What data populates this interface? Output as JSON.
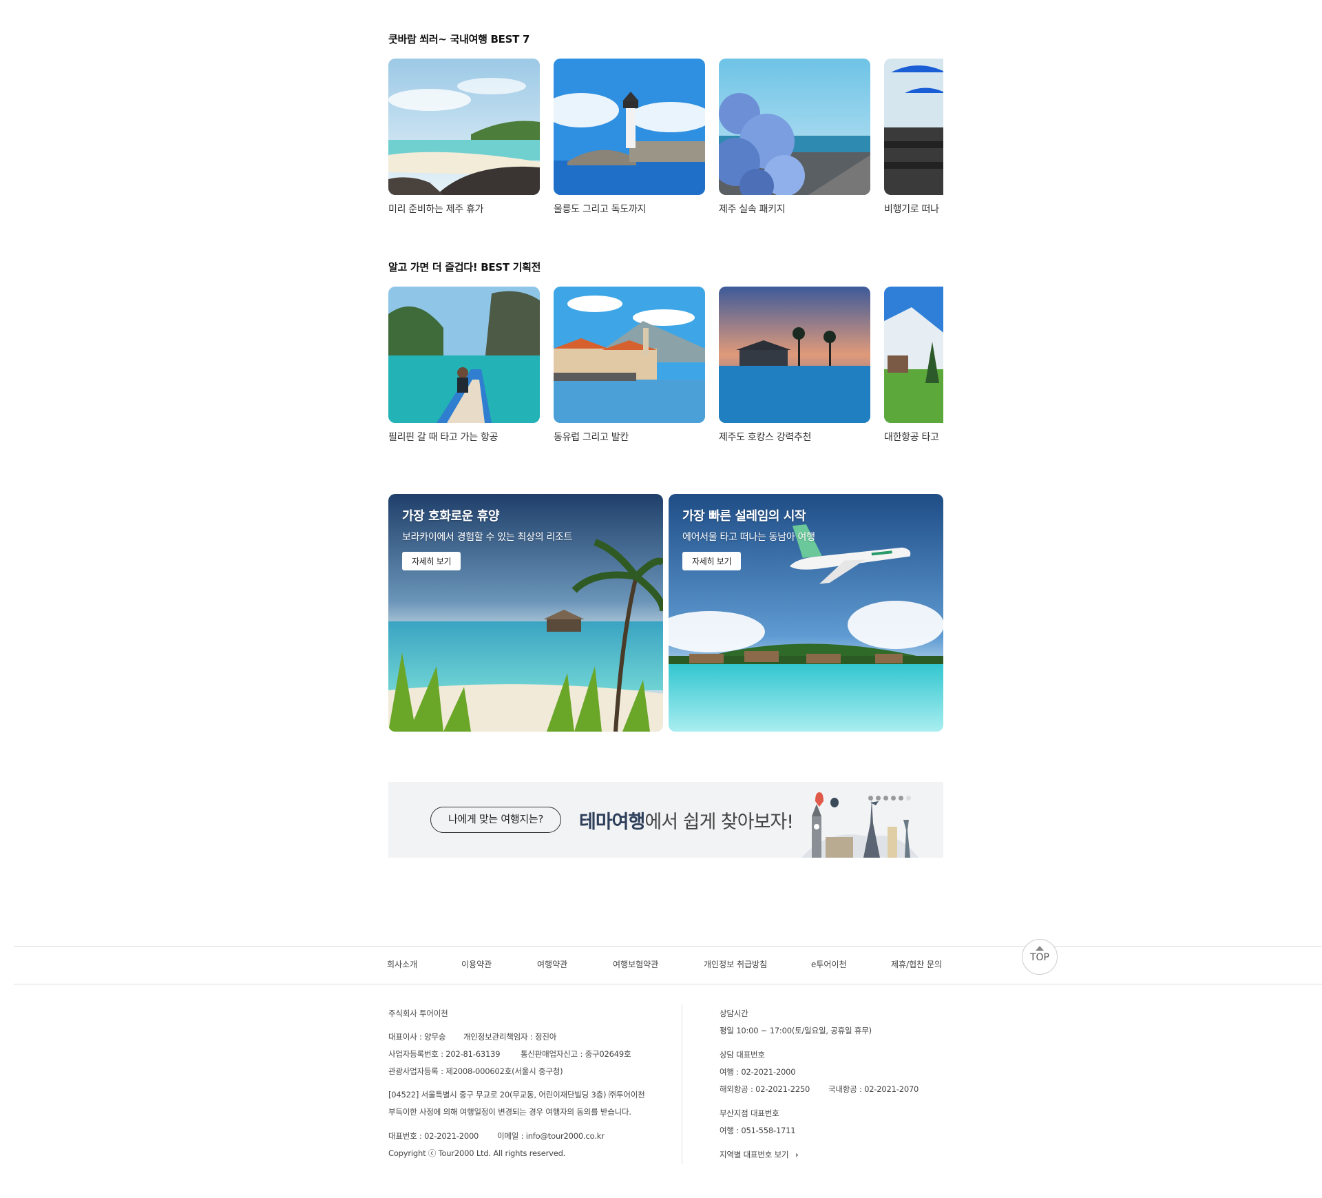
{
  "section1": {
    "title": "쿳바람 쐬러~ 국내여행 BEST 7",
    "cards": [
      {
        "caption": "미리 준비하는 제주 휴가"
      },
      {
        "caption": "울릉도 그리고 독도까지"
      },
      {
        "caption": "제주 실속 패키지"
      },
      {
        "caption": "비행기로 떠나"
      }
    ]
  },
  "section2": {
    "title": "알고 가면 더 즐겁다! BEST 기획전",
    "cards": [
      {
        "caption": "필리핀 갈 때 타고 가는 항공"
      },
      {
        "caption": "동유럽 그리고 발칸"
      },
      {
        "caption": "제주도 호캉스 강력추천"
      },
      {
        "caption": "대한항공 타고"
      }
    ]
  },
  "promos": [
    {
      "heading": "가장 호화로운 휴양",
      "sub": "보라카이에서 경험할 수 있는 최상의 리조트",
      "button": "자세히 보기"
    },
    {
      "heading": "가장 빠른 설레임의 시작",
      "sub": "에어서울 타고 떠나는 동남아 여행",
      "button": "자세히 보기"
    }
  ],
  "theme_banner": {
    "pill": "나에게 맞는 여행지는?",
    "slogan_bold": "테마여행",
    "slogan_rest": "에서 쉽게 찾아보자!"
  },
  "footer_nav": [
    "회사소개",
    "이용약관",
    "여행약관",
    "여행보험약관",
    "개인정보 취급방침",
    "e투어이천",
    "제휴/협찬 문의"
  ],
  "top_button": "TOP",
  "company": {
    "name": "주식회사 투어이천",
    "ceo": "대표이사 : 양무승",
    "privacy_officer": "개인정보관리책임자 : 정진아",
    "biz_reg": "사업자등록번호 : 202-81-63139",
    "mail_order": "통신판매업자신고 : 중구02649호",
    "tour_reg": "관광사업자등록 : 제2008-000602호(서울시 중구청)",
    "address": "[04522] 서울특별시 중구 무교로 20(무교동, 어린이재단빌딩 3층) ㈜투어이천",
    "notice": "부득이한 사정에 의해 여행일정이 변경되는 경우 여행자의 동의를 받습니다.",
    "phone": "대표번호 : 02-2021-2000",
    "email": "이메일 : info@tour2000.co.kr",
    "copyright": "Copyright ⓒ Tour2000 Ltd. All rights reserved."
  },
  "contact": {
    "hours_title": "상담시간",
    "hours": "평일 10:00 ~ 17:00(토/일요일, 공휴일 휴무)",
    "numbers_title": "상담 대표번호",
    "travel": "여행 : 02-2021-2000",
    "intl_air": "해외항공 : 02-2021-2250",
    "dom_air": "국내항공 : 02-2021-2070",
    "busan_title": "부산지점 대표번호",
    "busan_travel": "여행 : 051-558-1711",
    "regional_link": "지역별 대표번호 보기"
  }
}
